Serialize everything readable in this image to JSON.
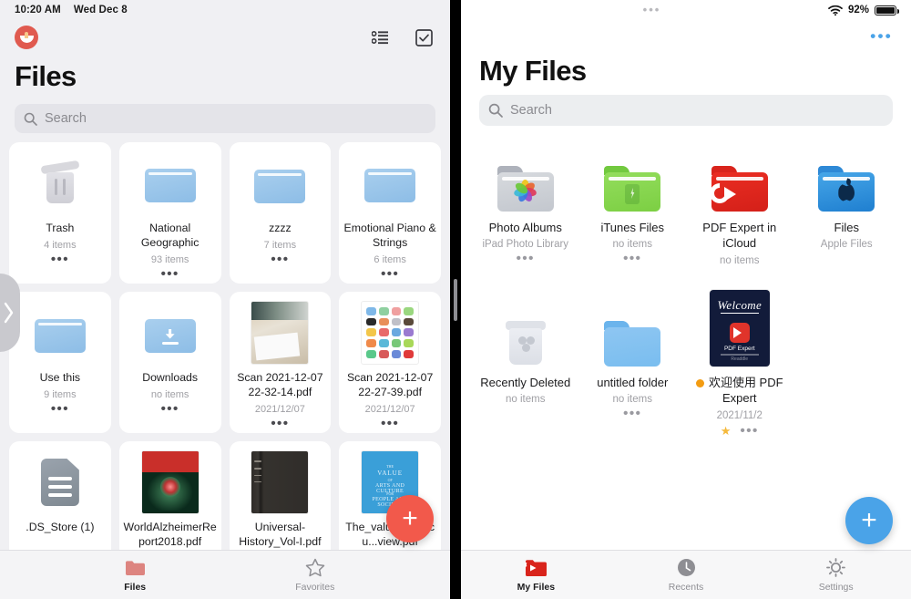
{
  "left": {
    "status": {
      "time": "10:20 AM",
      "date": "Wed Dec 8"
    },
    "app_logo": "readdle-documents-logo",
    "nav_icons": [
      {
        "name": "list-view-icon",
        "label": "List View"
      },
      {
        "name": "select-checkbox-icon",
        "label": "Select"
      }
    ],
    "title": "Files",
    "search": {
      "placeholder": "Search",
      "value": ""
    },
    "fab_label": "+",
    "fab_color": "#f2594b",
    "items": [
      {
        "name": "Trash",
        "meta": "4 items",
        "icon": "trash-icon",
        "dots": "•••"
      },
      {
        "name": "National Geographic",
        "meta": "93 items",
        "icon": "folder-icon",
        "dots": "•••"
      },
      {
        "name": "zzzz",
        "meta": "7 items",
        "icon": "folder-icon",
        "dots": "•••"
      },
      {
        "name": "Emotional Piano & Strings",
        "meta": "6 items",
        "icon": "folder-icon",
        "dots": "•••"
      },
      {
        "name": "Use this",
        "meta": "9 items",
        "icon": "folder-icon",
        "dots": "•••"
      },
      {
        "name": "Downloads",
        "meta": "no items",
        "icon": "downloads-folder-icon",
        "dots": "•••"
      },
      {
        "name": "Scan 2021-12-07 22-32-14.pdf",
        "meta": "2021/12/07",
        "icon": "scan-photo-thumbnail",
        "dots": "•••"
      },
      {
        "name": "Scan 2021-12-07 22-27-39.pdf",
        "meta": "2021/12/07",
        "icon": "scan-screenshot-thumbnail",
        "dots": "•••"
      },
      {
        "name": ".DS_Store (1)",
        "meta": "",
        "icon": "generic-file-icon",
        "dots": ""
      },
      {
        "name": "WorldAlzheimerReport2018.pdf",
        "meta": "",
        "icon": "pdf-cover-thumbnail",
        "dots": ""
      },
      {
        "name": "Universal-History_Vol-I.pdf",
        "meta": "",
        "icon": "book-cover-thumbnail",
        "dots": ""
      },
      {
        "name": "The_value_and_cu...view.pdf",
        "meta": "",
        "icon": "pdf-cover-thumbnail",
        "dots": ""
      }
    ],
    "value_pdf_cover_lines": [
      "THE",
      "VALUE",
      "OF",
      "ARTS AND CULTURE",
      "FOR",
      "PEOPLE AND SOCIETY"
    ],
    "tabs": [
      {
        "label": "Files",
        "icon": "folder-tab-icon",
        "active": true
      },
      {
        "label": "Favorites",
        "icon": "star-tab-icon",
        "active": false
      }
    ]
  },
  "right": {
    "status": {
      "center": "•••",
      "battery_percent": "92%",
      "wifi": "wifi-icon"
    },
    "more_menu": "•••",
    "title": "My Files",
    "search": {
      "placeholder": "Search",
      "value": ""
    },
    "fab_label": "+",
    "fab_color": "#4aa3e8",
    "items": [
      {
        "name": "Photo Albums",
        "meta": "iPad Photo Library",
        "icon": "photos-folder-icon",
        "dots": "•••",
        "star": false
      },
      {
        "name": "iTunes Files",
        "meta": "no items",
        "icon": "itunes-folder-icon",
        "dots": "•••",
        "star": false
      },
      {
        "name": "PDF Expert in iCloud",
        "meta": "no items",
        "icon": "pdfexpert-folder-icon",
        "dots": "",
        "star": false
      },
      {
        "name": "Files",
        "meta": "Apple Files",
        "icon": "apple-files-folder-icon",
        "dots": "",
        "star": false
      },
      {
        "name": "Recently Deleted",
        "meta": "no items",
        "icon": "recently-deleted-icon",
        "dots": "",
        "star": false
      },
      {
        "name": "untitled folder",
        "meta": "no items",
        "icon": "folder-icon",
        "dots": "•••",
        "star": false
      },
      {
        "name": "欢迎使用 PDF Expert",
        "meta": "2021/11/2",
        "icon": "welcome-pdf-thumbnail",
        "dots": "•••",
        "star": true,
        "status_dot": "#f39c12"
      }
    ],
    "welcome_thumb": {
      "title": "Welcome",
      "app": "PDF Expert",
      "footer": "Readdle"
    },
    "tabs": [
      {
        "label": "My Files",
        "icon": "pdfexpert-folder-tab-icon",
        "active": true
      },
      {
        "label": "Recents",
        "icon": "clock-tab-icon",
        "active": false
      },
      {
        "label": "Settings",
        "icon": "gear-tab-icon",
        "active": false
      }
    ]
  },
  "divider": {
    "name": "split-view-divider-grip"
  },
  "drawer_handle": {
    "name": "side-drawer-chevron"
  }
}
